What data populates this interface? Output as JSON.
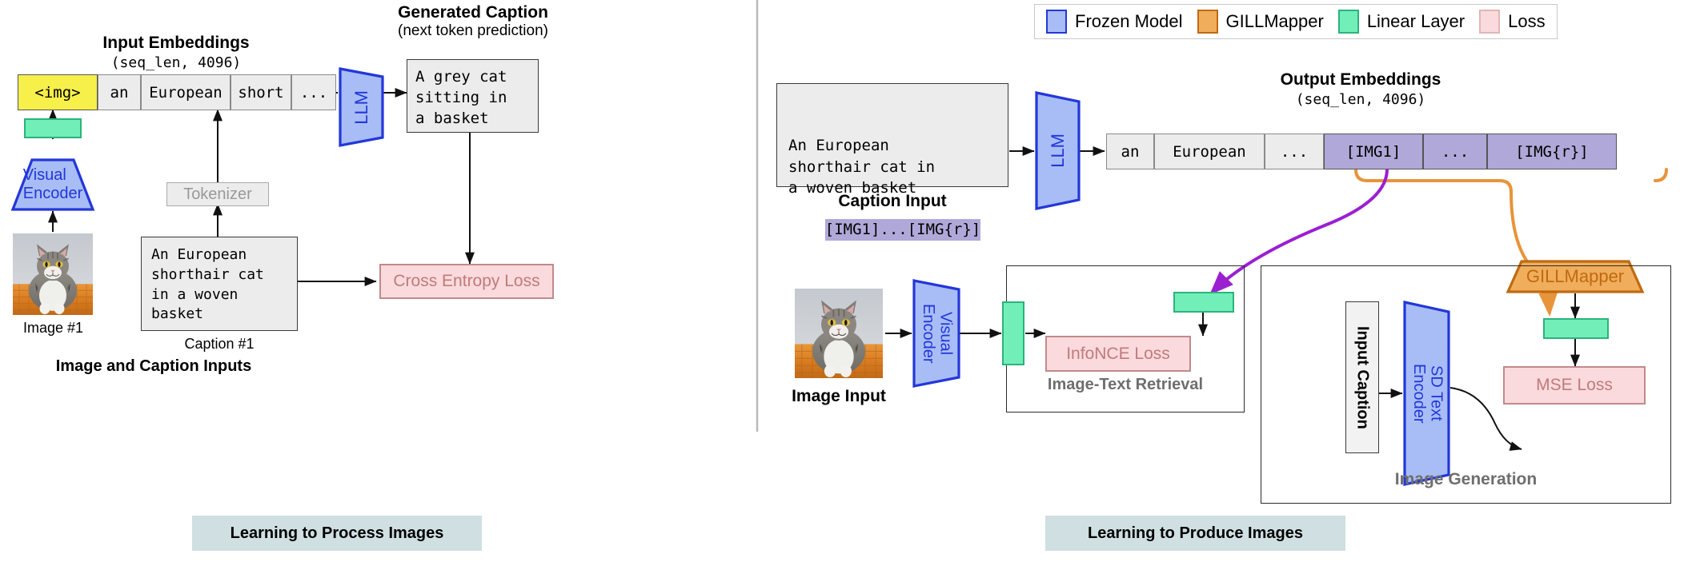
{
  "legend": {
    "items": [
      {
        "label": "Frozen Model",
        "fill": "#a8bdf5",
        "stroke": "#2337d8"
      },
      {
        "label": "GILLMapper",
        "fill": "#f0ad5c",
        "stroke": "#c06a10"
      },
      {
        "label": "Linear Layer",
        "fill": "#72eeb8",
        "stroke": "#2bb37c"
      },
      {
        "label": "Loss",
        "fill": "#fadadd",
        "stroke": "#e0b6b6"
      }
    ]
  },
  "left_panel": {
    "input_embeddings": {
      "title": "Input Embeddings",
      "shape": "(seq_len, 4096)",
      "tokens": [
        "<img>",
        "an",
        "European",
        "short",
        "..."
      ]
    },
    "llm_label": "LLM",
    "generated_caption": {
      "title": "Generated Caption",
      "subtitle": "(next token prediction)",
      "text": "A grey cat\nsitting in\na basket"
    },
    "visual_encoder_label": "Visual\nEncoder",
    "tokenizer_label": "Tokenizer",
    "caption_text": "An European\nshorthair cat\nin a woven\nbasket",
    "image_caption": "Image #1",
    "caption_caption": "Caption #1",
    "inputs_label": "Image and Caption Inputs",
    "loss_label": "Cross Entropy Loss",
    "banner": "Learning to Process Images"
  },
  "right_panel": {
    "caption_input": {
      "text": "An European\nshorthair cat in\na woven basket",
      "img_tokens": "[IMG1]...[IMG{r}]",
      "label": "Caption Input"
    },
    "llm_label": "LLM",
    "output_embeddings": {
      "title": "Output Embeddings",
      "shape": "(seq_len, 4096)",
      "tokens": [
        {
          "text": "an",
          "kind": "text"
        },
        {
          "text": "European",
          "kind": "text"
        },
        {
          "text": "...",
          "kind": "text"
        },
        {
          "text": "[IMG1]",
          "kind": "img"
        },
        {
          "text": "...",
          "kind": "img"
        },
        {
          "text": "[IMG{r}]",
          "kind": "img"
        }
      ]
    },
    "image_input_label": "Image Input",
    "visual_encoder_label": "Visual\nEncoder",
    "retrieval": {
      "panel_label": "Image-Text Retrieval",
      "loss_label": "InfoNCE Loss"
    },
    "generation": {
      "panel_label": "Image Generation",
      "input_caption_label": "Input Caption",
      "sd_text_encoder_label": "SD Text\nEncoder",
      "gillmapper_label": "GILLMapper",
      "loss_label": "MSE Loss"
    },
    "banner": "Learning to Produce Images"
  },
  "colors": {
    "frozen_fill": "#a8bdf5",
    "frozen_stroke": "#2337d8",
    "mapper_fill": "#f0ad5c",
    "mapper_stroke": "#c06a10",
    "linear_fill": "#72eeb8",
    "linear_stroke": "#2bb37c",
    "loss_fill": "#fadadd",
    "loss_stroke": "#c08a8a",
    "purple_arrow": "#9b1fd0",
    "orange_arrow": "#e8943a",
    "banner_bg": "#cfdfe2"
  }
}
